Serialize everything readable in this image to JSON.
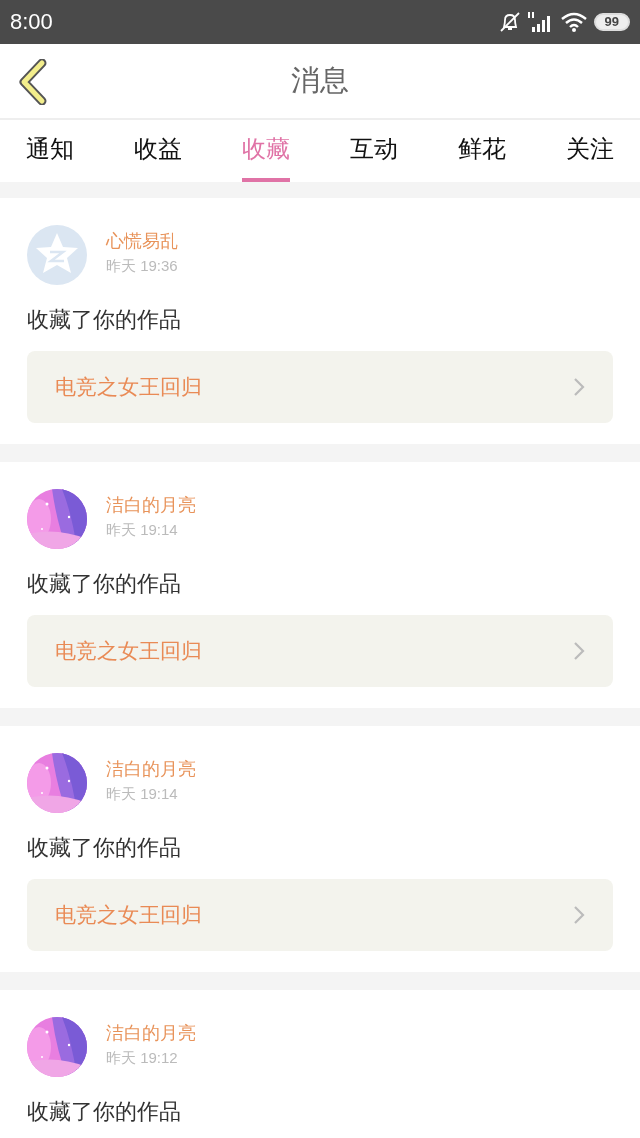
{
  "status_bar": {
    "time": "8:00",
    "battery": "99"
  },
  "header": {
    "title": "消息"
  },
  "tabs": [
    {
      "label": "通知",
      "selected": false
    },
    {
      "label": "收益",
      "selected": false
    },
    {
      "label": "收藏",
      "selected": true
    },
    {
      "label": "互动",
      "selected": false
    },
    {
      "label": "鲜花",
      "selected": false
    },
    {
      "label": "关注",
      "selected": false
    }
  ],
  "messages": [
    {
      "avatar": {
        "kind": "default"
      },
      "user": "心慌易乱",
      "time": "昨天 19:36",
      "action": "收藏了你的作品",
      "work": "电竞之女王回归"
    },
    {
      "user": "洁白的月亮",
      "time": "昨天 19:14",
      "action": "收藏了你的作品",
      "work": "电竞之女王回归"
    },
    {
      "user": "洁白的月亮",
      "time": "昨天 19:14",
      "action": "收藏了你的作品",
      "work": "电竞之女王回归"
    },
    {
      "user": "洁白的月亮",
      "time": "昨天 19:12",
      "action": "收藏了你的作品"
    }
  ]
}
